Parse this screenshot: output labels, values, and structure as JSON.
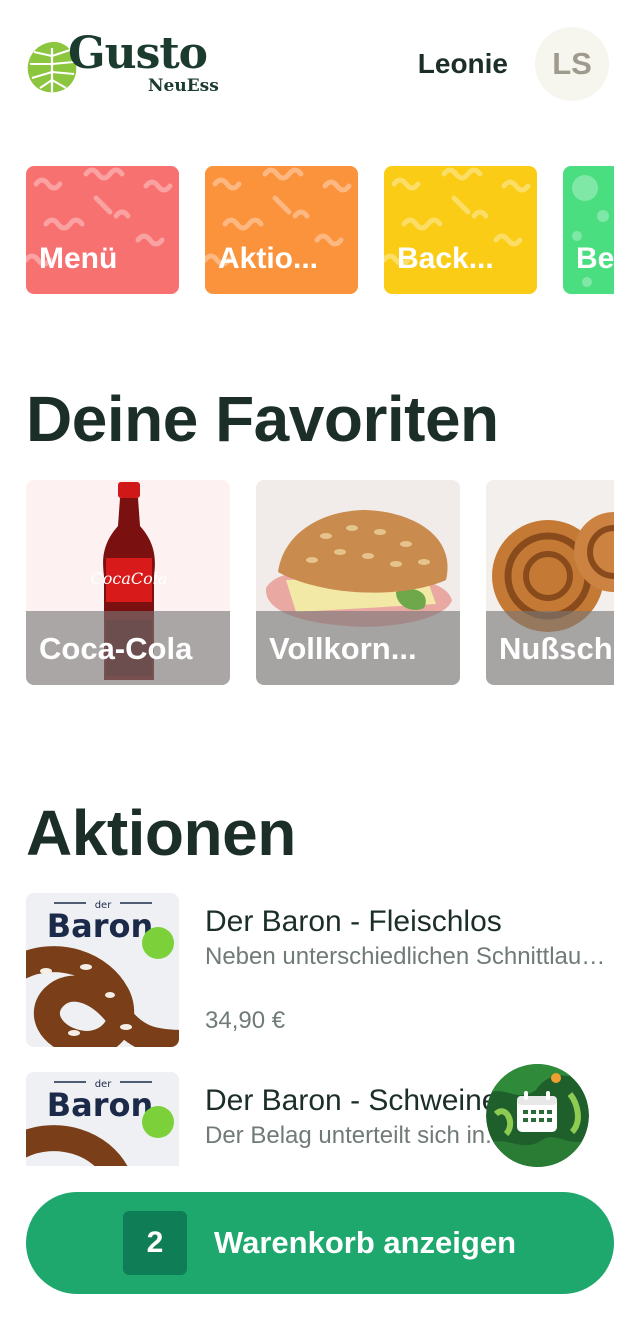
{
  "header": {
    "logo_text": "Gusto",
    "logo_subtext": "NeuEss",
    "user_name": "Leonie",
    "avatar_initials": "LS"
  },
  "categories": [
    {
      "label": "Menü",
      "color": "#f87171"
    },
    {
      "label": "Aktio...",
      "color": "#fb923c"
    },
    {
      "label": "Back...",
      "color": "#facc15"
    },
    {
      "label": "Be",
      "color": "#4ade80"
    }
  ],
  "favorites": {
    "title": "Deine Favoriten",
    "items": [
      {
        "label": "Coca-Cola",
        "icon": "cola-bottle-image"
      },
      {
        "label": "Vollkorn...",
        "icon": "sandwich-image"
      },
      {
        "label": "Nußsch",
        "icon": "pastry-image"
      }
    ]
  },
  "promotions": {
    "title": "Aktionen",
    "items": [
      {
        "title": "Der Baron - Fleischlos",
        "description": "Neben unterschiedlichen Schnittlauch...",
        "price": "34,90 €",
        "image_brand_small": "der",
        "image_brand": "Baron"
      },
      {
        "title": "Der Baron - Schweinebraten",
        "description": "Der Belag unterteilt sich in...",
        "image_brand_small": "der",
        "image_brand": "Baron"
      }
    ]
  },
  "fab": {
    "icon": "calendar-icon"
  },
  "cart": {
    "count": "2",
    "label": "Warenkorb anzeigen",
    "color": "#1fa86e"
  }
}
